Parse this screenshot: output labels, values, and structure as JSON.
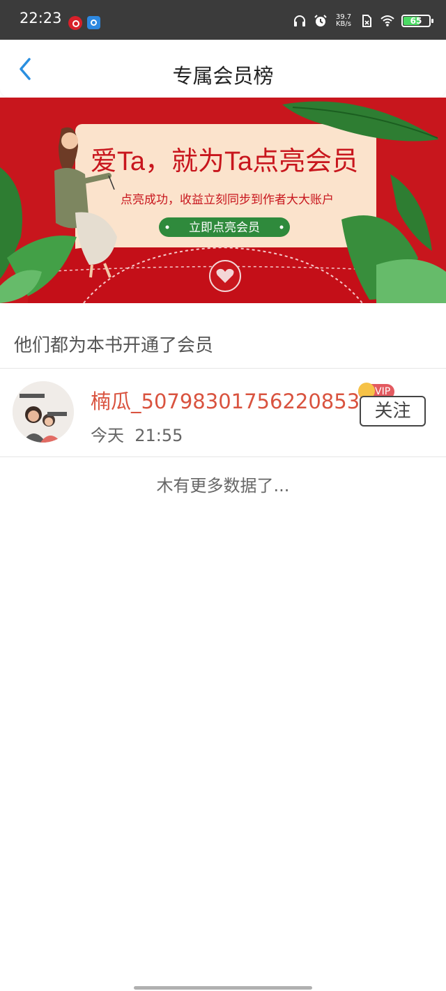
{
  "status_bar": {
    "time": "22:23",
    "net_speed_value": "39.7",
    "net_speed_unit": "KB/s",
    "battery": "65",
    "icons": [
      "netease-music-icon",
      "broadcast-app-icon",
      "headphones-icon",
      "alarm-icon",
      "sim-icon",
      "wifi-icon",
      "battery-icon"
    ]
  },
  "header": {
    "title": "专属会员榜",
    "back_icon": "chevron-left-icon"
  },
  "banner": {
    "headline": "爱Ta，就为Ta点亮会员",
    "subline": "点亮成功，收益立刻同步到作者大大账户",
    "cta": "立即点亮会员"
  },
  "section": {
    "title": "他们都为本书开通了会员"
  },
  "members": [
    {
      "name": "楠瓜_50798301756220853",
      "time": "今天  21:55",
      "badge": "VIP",
      "follow_label": "关注"
    }
  ],
  "footer": {
    "no_more": "木有更多数据了..."
  },
  "colors": {
    "accent_blue": "#2a8fe0",
    "name_red": "#d9533f",
    "banner_red": "#c8161d",
    "banner_cream": "#fbe3cc",
    "cta_green": "#2f8a3c"
  }
}
